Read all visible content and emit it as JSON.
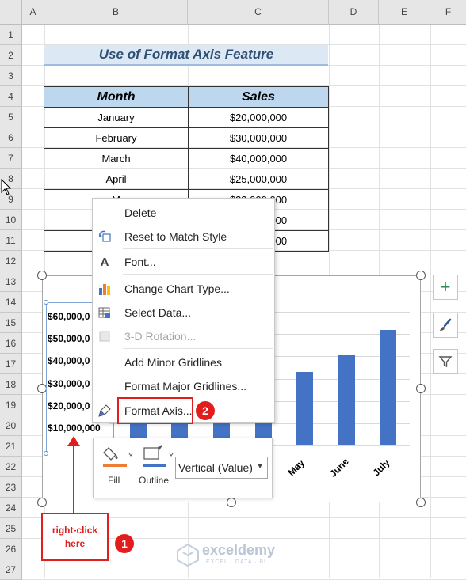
{
  "sheet": {
    "columns": [
      "A",
      "B",
      "C",
      "D",
      "E",
      "F"
    ],
    "rows": [
      "1",
      "2",
      "3",
      "4",
      "5",
      "6",
      "7",
      "8",
      "9",
      "10",
      "11",
      "12",
      "13",
      "14",
      "15",
      "16",
      "17",
      "18",
      "19",
      "20",
      "21",
      "22",
      "23",
      "24",
      "25",
      "26",
      "27"
    ]
  },
  "title": "Use of Format Axis Feature",
  "table": {
    "headers": [
      "Month",
      "Sales"
    ],
    "rows": [
      [
        "January",
        "$20,000,000"
      ],
      [
        "February",
        "$30,000,000"
      ],
      [
        "March",
        "$40,000,000"
      ],
      [
        "April",
        "$25,000,000"
      ],
      [
        "M",
        "$33,000,000"
      ],
      [
        "",
        "$35,000,000"
      ],
      [
        "",
        "$45,000,000"
      ]
    ]
  },
  "chart_data": {
    "type": "bar",
    "categories": [
      "January",
      "February",
      "March",
      "April",
      "May",
      "June",
      "July"
    ],
    "values": [
      20000000,
      30000000,
      40000000,
      25000000,
      33000000,
      40500000,
      52000000
    ],
    "visible_x_labels": [
      "May",
      "June",
      "July"
    ],
    "y_tick_labels": [
      "$60,000,0",
      "$50,000,0",
      "$40,000,0",
      "$30,000,0",
      "$20,000,0",
      "$10,000,000"
    ],
    "ylim": [
      0,
      60000000
    ],
    "grid": true,
    "bar_color": "#4472c4"
  },
  "side_buttons": {
    "elements": "+",
    "styles": "brush-icon",
    "filters": "filter-icon"
  },
  "context_menu": {
    "items": [
      {
        "label": "Delete",
        "icon": "",
        "enabled": true
      },
      {
        "label": "Reset to Match Style",
        "icon": "reset-style-icon",
        "enabled": true
      },
      {
        "label": "Font...",
        "icon": "A",
        "enabled": true
      },
      {
        "label": "Change Chart Type...",
        "icon": "chart-type-icon",
        "enabled": true
      },
      {
        "label": "Select Data...",
        "icon": "select-data-icon",
        "enabled": true
      },
      {
        "label": "3-D Rotation...",
        "icon": "rotation-icon",
        "enabled": false
      },
      {
        "label": "Add Minor Gridlines",
        "icon": "",
        "enabled": true
      },
      {
        "label": "Format Major Gridlines...",
        "icon": "",
        "enabled": true
      },
      {
        "label": "Format Axis...",
        "icon": "format-axis-icon",
        "enabled": true
      }
    ]
  },
  "mini_toolbar": {
    "fill_label": "Fill",
    "outline_label": "Outline",
    "element_select": "Vertical (Value)",
    "fill_color": "#ed7d31",
    "outline_color": "#4472c4"
  },
  "annotations": {
    "note": "right-click here",
    "badge1": "1",
    "badge2": "2",
    "color": "#e21d1d"
  },
  "watermark": {
    "name": "exceldemy",
    "tagline": "EXCEL · DATA · BI"
  }
}
